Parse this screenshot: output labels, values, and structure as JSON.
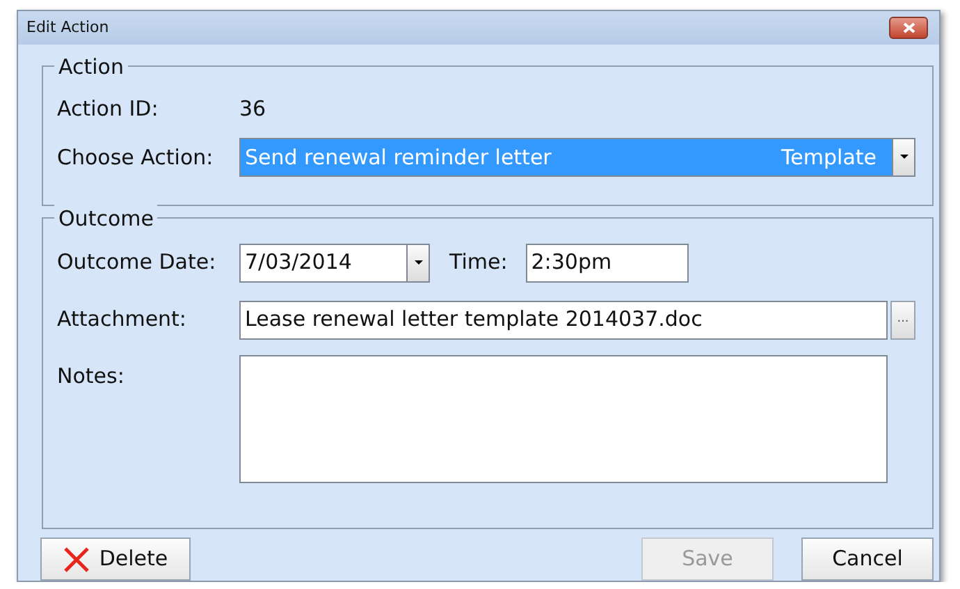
{
  "window": {
    "title": "Edit Action"
  },
  "action_group": {
    "legend": "Action",
    "action_id": {
      "label": "Action ID:",
      "value": "36"
    },
    "choose_action": {
      "label": "Choose Action:",
      "value": "Send renewal reminder letter",
      "tag": "Template",
      "selected": true
    }
  },
  "outcome_group": {
    "legend": "Outcome",
    "outcome_date": {
      "label": "Outcome Date:",
      "value": "7/03/2014"
    },
    "time": {
      "label": "Time:",
      "value": "2:30pm"
    },
    "attachment": {
      "label": "Attachment:",
      "value": "Lease renewal letter template 2014037.doc",
      "browse": "..."
    },
    "notes": {
      "label": "Notes:"
    }
  },
  "buttons": [
    {
      "label": "Delete",
      "kind": "delete",
      "disabled": false
    },
    {
      "label": "Save",
      "kind": "plain",
      "disabled": true
    },
    {
      "label": "Cancel",
      "kind": "plain",
      "disabled": false
    }
  ]
}
